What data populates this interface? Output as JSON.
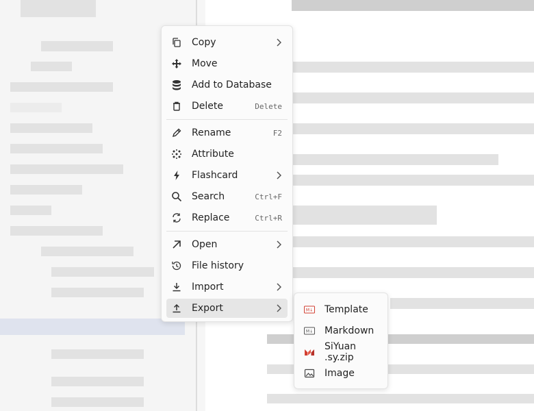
{
  "menu": {
    "items": [
      {
        "label": "Copy",
        "icon": "copy-icon",
        "submenu": true
      },
      {
        "label": "Move",
        "icon": "move-icon"
      },
      {
        "label": "Add to Database",
        "icon": "database-icon"
      },
      {
        "label": "Delete",
        "icon": "trash-icon",
        "shortcut": "Delete"
      },
      {
        "label": "Rename",
        "icon": "pencil-icon",
        "shortcut": "F2"
      },
      {
        "label": "Attribute",
        "icon": "attribute-icon"
      },
      {
        "label": "Flashcard",
        "icon": "bolt-icon",
        "submenu": true
      },
      {
        "label": "Search",
        "icon": "search-icon",
        "shortcut": "Ctrl+F"
      },
      {
        "label": "Replace",
        "icon": "replace-icon",
        "shortcut": "Ctrl+R"
      },
      {
        "label": "Open",
        "icon": "arrow-up-right-icon",
        "submenu": true
      },
      {
        "label": "File history",
        "icon": "history-icon"
      },
      {
        "label": "Import",
        "icon": "import-icon",
        "submenu": true
      },
      {
        "label": "Export",
        "icon": "export-icon",
        "submenu": true,
        "active": true
      }
    ]
  },
  "export_submenu": {
    "items": [
      {
        "label": "Template",
        "icon": "template-icon"
      },
      {
        "label": "Markdown",
        "icon": "markdown-icon"
      },
      {
        "label": "SiYuan .sy.zip",
        "icon": "siyuan-icon"
      },
      {
        "label": "Image",
        "icon": "image-icon"
      }
    ]
  },
  "colors": {
    "menu_bg": "#fbfbfb",
    "active_bg": "#e6e6e6",
    "siyuan_red": "#d23f31"
  }
}
